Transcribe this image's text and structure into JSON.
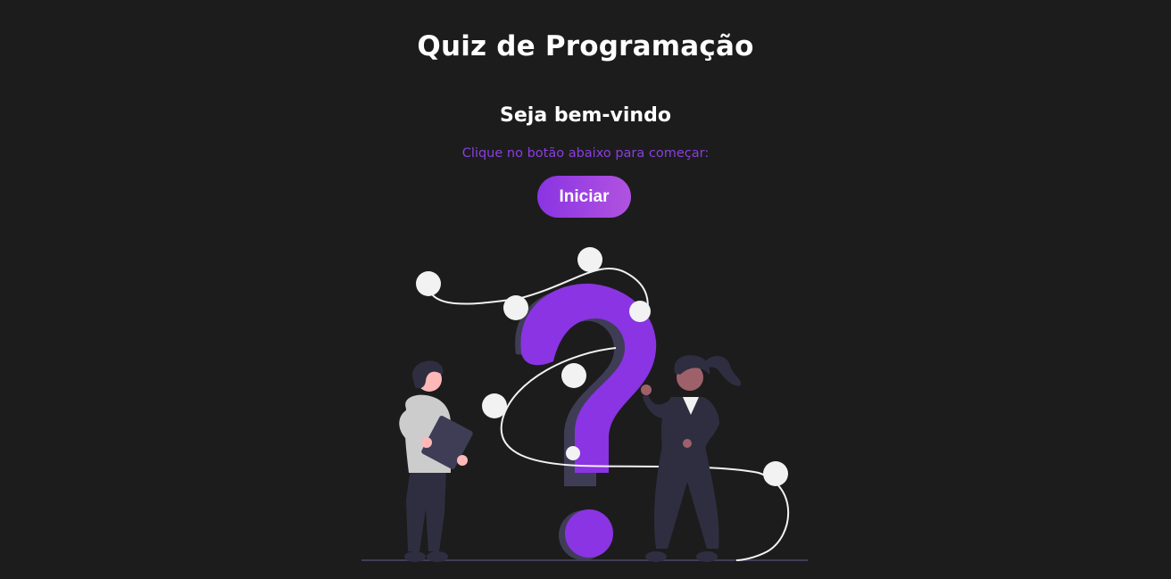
{
  "header": {
    "title": "Quiz de Programação"
  },
  "start_screen": {
    "heading": "Seja bem-vindo",
    "instruction": "Clique no botão abaixo para começar:",
    "start_button_label": "Iniciar"
  },
  "illustration": {
    "icon": "question-mark-illustration",
    "accent_color": "#8a34e3"
  },
  "colors": {
    "background": "#1c1c1c",
    "accent": "#8a34e3",
    "accent_gradient_end": "#b153e0",
    "text": "#ffffff"
  }
}
